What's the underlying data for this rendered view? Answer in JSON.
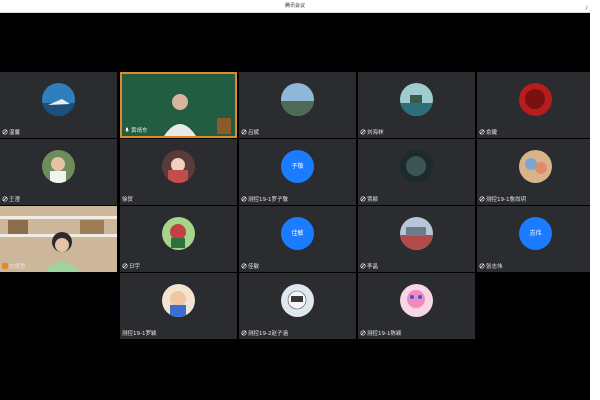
{
  "window": {
    "title": "腾讯会议"
  },
  "participants": [
    {
      "name": "温馨",
      "avatar": "sea-photo",
      "mic": "muted"
    },
    {
      "name": "黄靖东",
      "avatar": "camera-video",
      "mic": "on",
      "active": true
    },
    {
      "name": "吕斌",
      "avatar": "landscape-photo",
      "mic": "muted"
    },
    {
      "name": "刘海林",
      "avatar": "island-photo",
      "mic": "muted"
    },
    {
      "name": "俞婕",
      "avatar": "red-tree-photo",
      "mic": "muted"
    },
    {
      "name": "王澄",
      "avatar": "person-photo",
      "mic": "muted"
    },
    {
      "name": "徐贺",
      "avatar": "girl-photo",
      "mic": "none"
    },
    {
      "name": "测控19-1罗子敬",
      "avatar": "text",
      "avatar_text": "子敬",
      "mic": "muted"
    },
    {
      "name": "贾颖",
      "avatar": "dark-photo",
      "mic": "muted"
    },
    {
      "name": "测控19-1詹尚玥",
      "avatar": "cartoon-photo",
      "mic": "muted"
    },
    {
      "name": "方俊思",
      "avatar": "camera-video-2",
      "mic": "speaking"
    },
    {
      "name": "日宇",
      "avatar": "cartoon-green",
      "mic": "muted"
    },
    {
      "name": "佳敏",
      "avatar": "text",
      "avatar_text": "佳敏",
      "mic": "muted"
    },
    {
      "name": "李晶",
      "avatar": "city-photo",
      "mic": "muted"
    },
    {
      "name": "张志伟",
      "avatar": "text",
      "avatar_text": "志伟",
      "mic": "muted"
    },
    {
      "name": "测控19-1罗颖",
      "avatar": "kid-photo",
      "mic": "none"
    },
    {
      "name": "测控19-2赵子涵",
      "avatar": "anime-photo",
      "mic": "muted"
    },
    {
      "name": "测控19-1陈颖",
      "avatar": "pink-cartoon",
      "mic": "muted"
    }
  ],
  "colors": {
    "accent": "#1b7cff",
    "active_border": "#e08a2a",
    "tile_bg": "#2a2c30"
  }
}
